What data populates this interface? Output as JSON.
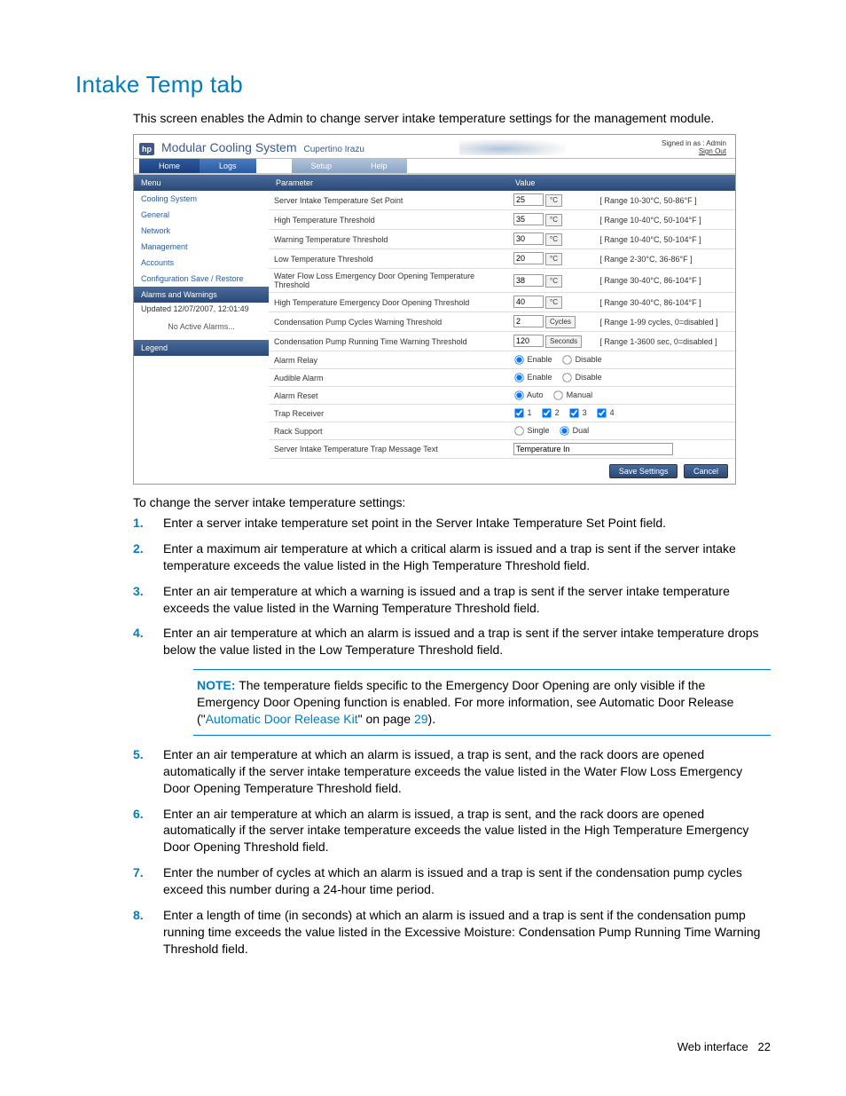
{
  "page": {
    "title": "Intake Temp tab",
    "intro": "This screen enables the Admin to change server intake temperature settings for the management module.",
    "lead2": "To change the server intake temperature settings:",
    "footer_section": "Web interface",
    "footer_page": "22"
  },
  "screenshot": {
    "brand_logo": "hp",
    "brand_title": "Modular Cooling System",
    "brand_sub": "Cupertino Irazu",
    "signed_in": "Signed in as : Admin",
    "signout": "Sign Out",
    "tabs": {
      "home": "Home",
      "logs": "Logs",
      "setup": "Setup",
      "help": "Help"
    },
    "sidebar": {
      "menu_head": "Menu",
      "items": [
        "Cooling System",
        "General",
        "Network",
        "Management",
        "Accounts",
        "Configuration Save / Restore"
      ],
      "alarms_head": "Alarms and Warnings",
      "alarms_updated": "Updated 12/07/2007, 12:01:49",
      "alarms_none": "No Active Alarms...",
      "legend_head": "Legend"
    },
    "table": {
      "col_param": "Parameter",
      "col_value": "Value",
      "rows": [
        {
          "label": "Server Intake Temperature Set Point",
          "value": "25",
          "unit": "°C",
          "range": "[ Range 10-30°C, 50-86°F ]"
        },
        {
          "label": "High Temperature Threshold",
          "value": "35",
          "unit": "°C",
          "range": "[ Range 10-40°C, 50-104°F ]"
        },
        {
          "label": "Warning Temperature Threshold",
          "value": "30",
          "unit": "°C",
          "range": "[ Range 10-40°C, 50-104°F ]"
        },
        {
          "label": "Low Temperature Threshold",
          "value": "20",
          "unit": "°C",
          "range": "[ Range 2-30°C, 36-86°F ]"
        },
        {
          "label": "Water Flow Loss Emergency Door Opening Temperature Threshold",
          "value": "38",
          "unit": "°C",
          "range": "[ Range 30-40°C, 86-104°F ]"
        },
        {
          "label": "High Temperature Emergency Door Opening Threshold",
          "value": "40",
          "unit": "°C",
          "range": "[ Range 30-40°C, 86-104°F ]"
        },
        {
          "label": "Condensation Pump Cycles Warning Threshold",
          "value": "2",
          "unit": "Cycles",
          "range": "[ Range 1-99 cycles, 0=disabled ]"
        },
        {
          "label": "Condensation Pump Running Time Warning Threshold",
          "value": "120",
          "unit": "Seconds",
          "range": "[ Range 1-3600 sec, 0=disabled ]"
        }
      ],
      "alarm_relay": {
        "label": "Alarm Relay",
        "opt1": "Enable",
        "opt2": "Disable"
      },
      "audible_alarm": {
        "label": "Audible Alarm",
        "opt1": "Enable",
        "opt2": "Disable"
      },
      "alarm_reset": {
        "label": "Alarm Reset",
        "opt1": "Auto",
        "opt2": "Manual"
      },
      "trap_receiver": {
        "label": "Trap Receiver",
        "c1": "1",
        "c2": "2",
        "c3": "3",
        "c4": "4"
      },
      "rack_support": {
        "label": "Rack Support",
        "opt1": "Single",
        "opt2": "Dual"
      },
      "trap_msg": {
        "label": "Server Intake Temperature Trap Message Text",
        "value": "Temperature In"
      },
      "btn_save": "Save Settings",
      "btn_cancel": "Cancel"
    }
  },
  "steps": {
    "s1": "Enter a server intake temperature set point in the Server Intake Temperature Set Point field.",
    "s2": "Enter a maximum air temperature at which a critical alarm is issued and a trap is sent if the server intake temperature exceeds the value listed in the High Temperature Threshold field.",
    "s3": "Enter an air temperature at which a warning is issued and a trap is sent if the server intake temperature exceeds the value listed in the Warning Temperature Threshold field.",
    "s4": "Enter an air temperature at which an alarm is issued and a trap is sent if the server intake temperature drops below the value listed in the Low Temperature Threshold field.",
    "note_label": "NOTE:",
    "note_text_1": "  The temperature fields specific to the Emergency Door Opening are only visible if the Emergency Door Opening function is enabled. For more information, see Automatic Door Release (\"",
    "note_link": "Automatic Door Release Kit",
    "note_text_2": "\" on page ",
    "note_page": "29",
    "note_text_3": ").",
    "s5": "Enter an air temperature at which an alarm is issued, a trap is sent, and the rack doors are opened automatically if the server intake temperature exceeds the value listed in the Water Flow Loss Emergency Door Opening Temperature Threshold field.",
    "s6": "Enter an air temperature at which an alarm is issued, a trap is sent, and the rack doors are opened automatically if the server intake temperature exceeds the value listed in the High Temperature Emergency Door Opening Threshold field.",
    "s7": "Enter the number of cycles at which an alarm is issued and a trap is sent if the condensation pump cycles exceed this number during a 24-hour time period.",
    "s8": "Enter a length of time (in seconds) at which an alarm is issued and a trap is sent if the condensation pump running time exceeds the value listed in the Excessive Moisture: Condensation Pump Running Time Warning Threshold field."
  }
}
